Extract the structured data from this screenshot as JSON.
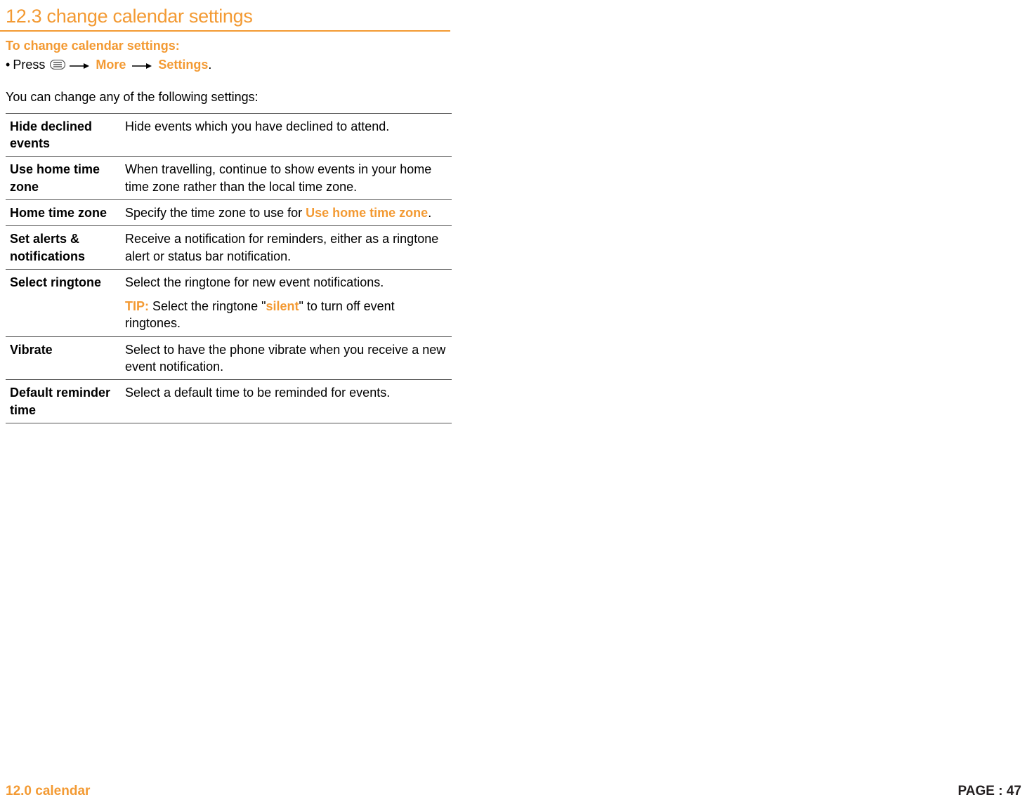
{
  "heading": "12.3 change calendar settings",
  "subheading": "To change calendar settings:",
  "instruction": {
    "bullet": "•",
    "press": "Press ",
    "more": "More",
    "settings": "Settings",
    "period": "."
  },
  "intro_text": "You can change any of the following settings:",
  "table": {
    "rows": [
      {
        "label": "Hide declined events",
        "desc": "Hide events which you have declined to attend."
      },
      {
        "label": "Use home time zone",
        "desc": "When travelling, continue to show events in your home time zone rather than the local time zone."
      },
      {
        "label": "Home time zone",
        "desc_prefix": "Specify the time zone to use for ",
        "desc_highlight": "Use home time zone",
        "desc_suffix": "."
      },
      {
        "label": "Set alerts & notifications",
        "desc": "Receive a notification for reminders, either as a ringtone alert or status bar notification."
      },
      {
        "label": "Select ringtone",
        "desc": "Select the ringtone for new event notifications.",
        "tip_label": "TIP:",
        "tip_prefix": " Select the ringtone \"",
        "tip_highlight": "silent",
        "tip_suffix": "\" to turn off event ringtones."
      },
      {
        "label": "Vibrate",
        "desc": "Select to have the phone vibrate when you receive a new event notification."
      },
      {
        "label": "Default reminder time",
        "desc": "Select a default time to be reminded for events."
      }
    ]
  },
  "footer": {
    "left": "12.0 calendar",
    "right": "PAGE : 47"
  }
}
